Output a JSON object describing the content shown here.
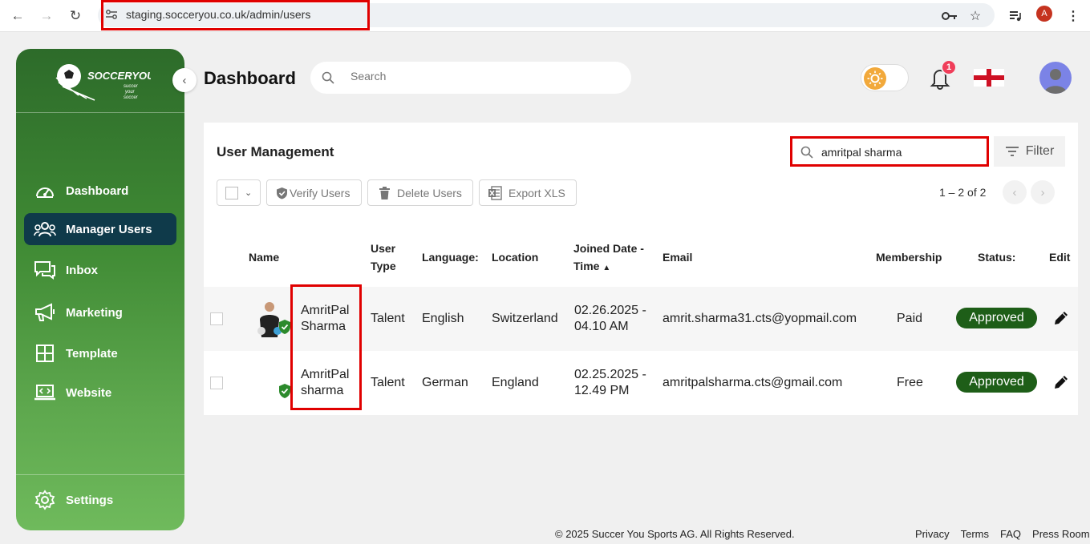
{
  "browser": {
    "url": "staging.socceryou.co.uk/admin/users",
    "profile_initial": "A"
  },
  "sidebar": {
    "logo_text": "SOCCERYOU",
    "logo_tagline": "succer your soccer",
    "items": [
      {
        "label": "Dashboard",
        "icon": "gauge-icon",
        "active": false
      },
      {
        "label": "Manager Users",
        "icon": "users-icon",
        "active": true
      },
      {
        "label": "Inbox",
        "icon": "chat-icon",
        "active": false
      },
      {
        "label": "Marketing",
        "icon": "megaphone-icon",
        "active": false
      },
      {
        "label": "Template",
        "icon": "grid-icon",
        "active": false
      },
      {
        "label": "Website",
        "icon": "laptop-code-icon",
        "active": false
      }
    ],
    "settings_label": "Settings"
  },
  "header": {
    "title": "Dashboard",
    "search_placeholder": "Search",
    "notification_count": "1"
  },
  "card": {
    "title": "User Management",
    "search_value": "amritpal sharma",
    "filter_label": "Filter",
    "toolbar": {
      "verify_label": "Verify Users",
      "delete_label": "Delete Users",
      "export_label": "Export XLS"
    },
    "pagination": "1 – 2 of 2",
    "columns": {
      "name": "Name",
      "user_type_1": "User",
      "user_type_2": "Type",
      "language": "Language:",
      "location": "Location",
      "joined_1": "Joined Date -",
      "joined_2": "Time",
      "email": "Email",
      "membership": "Membership",
      "status": "Status:",
      "edit": "Edit"
    },
    "rows": [
      {
        "first_name": "AmritPal",
        "last_name": "Sharma",
        "user_type": "Talent",
        "language": "English",
        "location": "Switzerland",
        "date_1": "02.26.2025 -",
        "date_2": "04.10 AM",
        "email": "amrit.sharma31.cts@yopmail.com",
        "membership": "Paid",
        "status": "Approved"
      },
      {
        "first_name": "AmritPal",
        "last_name": "sharma",
        "user_type": "Talent",
        "language": "German",
        "location": "England",
        "date_1": "02.25.2025 -",
        "date_2": "12.49 PM",
        "email": "amritpalsharma.cts@gmail.com",
        "membership": "Free",
        "status": "Approved"
      }
    ]
  },
  "footer": {
    "copyright": "© 2025 Succer You Sports AG. All Rights Reserved.",
    "links": [
      "Privacy",
      "Terms",
      "FAQ",
      "Press Room"
    ]
  },
  "colors": {
    "sidebar_top": "#2d6b2a",
    "sidebar_bottom": "#6fba5c",
    "active_nav": "#0f3a4a",
    "status_approved": "#1e5e18",
    "highlight": "#e00000"
  }
}
